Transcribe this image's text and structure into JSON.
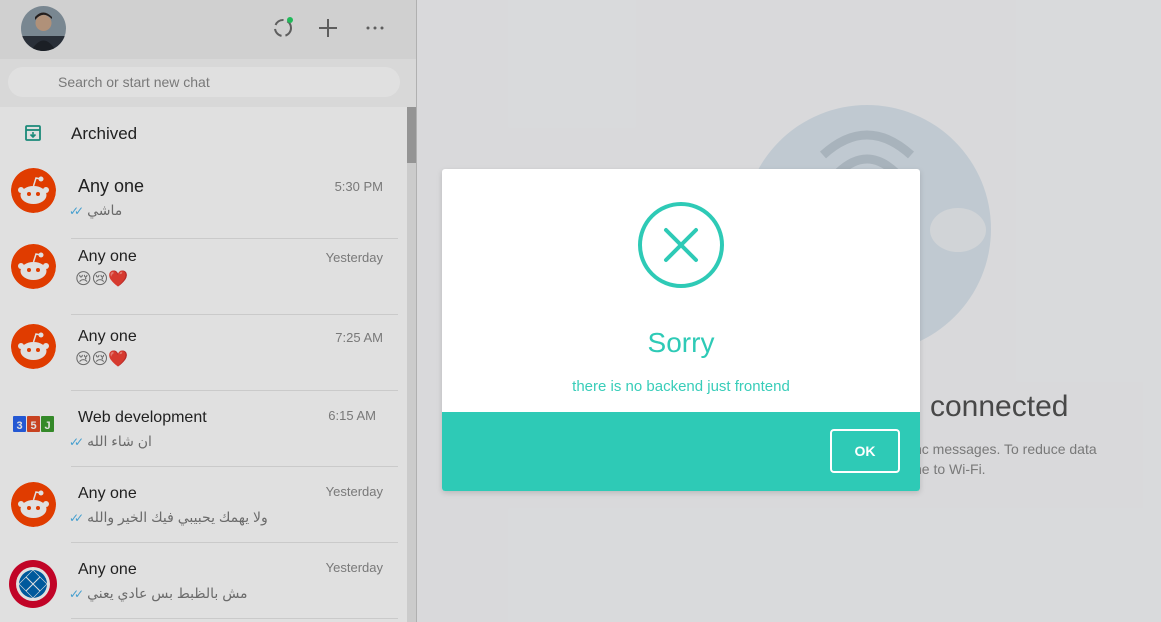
{
  "search": {
    "placeholder": "Search or start new chat"
  },
  "archived": {
    "label": "Archived"
  },
  "chats": [
    {
      "name": "Any one",
      "time": "5:30 PM",
      "preview": "ماشي",
      "ticks": true,
      "avatar": "reddit-avatar"
    },
    {
      "name": "Any one",
      "time": "Yesterday",
      "preview": "😢😢❤️",
      "ticks": false,
      "avatar": "reddit-avatar"
    },
    {
      "name": "Any one",
      "time": "7:25 AM",
      "preview": "😢😢❤️",
      "ticks": false,
      "avatar": "reddit-avatar"
    },
    {
      "name": "Web development",
      "time": "6:15 AM",
      "preview": "ان شاء الله",
      "ticks": true,
      "avatar": "html-css-js-avatar"
    },
    {
      "name": "Any one",
      "time": "Yesterday",
      "preview": "ولا يهمك يحبيبي فيك الخير والله",
      "ticks": true,
      "avatar": "reddit-avatar"
    },
    {
      "name": "Any one",
      "time": "Yesterday",
      "preview": "مش بالظبط بس عادي يعني",
      "ticks": true,
      "avatar": "fc-bayern-avatar"
    }
  ],
  "main": {
    "title": "connected",
    "text_line1": "nc messages. To reduce data",
    "text_line2": "ne to Wi-Fi."
  },
  "modal": {
    "title": "Sorry",
    "message": "there is no backend just frontend",
    "ok_label": "OK"
  },
  "colors": {
    "accent": "#2ecab6",
    "reddit": "#ff4500",
    "tick_blue": "#4fb6ec"
  },
  "icons": {
    "header": [
      "status-icon",
      "new-chat-icon",
      "menu-icon"
    ],
    "modal": "x-circle-icon"
  }
}
